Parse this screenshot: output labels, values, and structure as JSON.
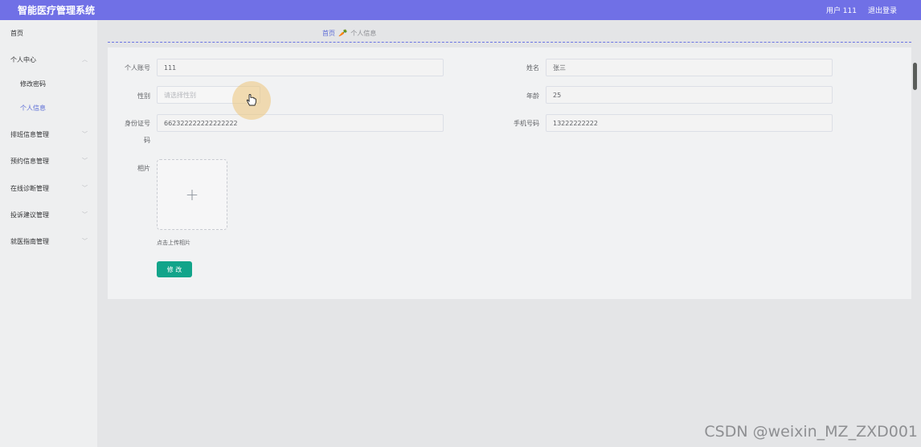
{
  "header": {
    "app_title": "智能医疗管理系统",
    "user_label": "用户 111",
    "logout_label": "退出登录"
  },
  "sidebar": {
    "items": [
      {
        "label": "首页",
        "expandable": false
      },
      {
        "label": "个人中心",
        "expandable": true,
        "expanded": true
      },
      {
        "label": "修改密码",
        "sub": true
      },
      {
        "label": "个人信息",
        "sub": true,
        "active": true
      },
      {
        "label": "排班信息管理",
        "expandable": true
      },
      {
        "label": "预约信息管理",
        "expandable": true
      },
      {
        "label": "在线诊断管理",
        "expandable": true
      },
      {
        "label": "投诉建议管理",
        "expandable": true
      },
      {
        "label": "就医指南管理",
        "expandable": true
      }
    ],
    "chevron_icon": "chevron-down-icon",
    "active_color": "#5b6cd6"
  },
  "breadcrumb": {
    "home": "首页",
    "separator_icon": "carrot-icon",
    "current": "个人信息"
  },
  "form": {
    "account": {
      "label": "个人账号",
      "value": "111"
    },
    "name": {
      "label": "姓名",
      "value": "张三"
    },
    "gender": {
      "label": "性别",
      "placeholder": "请选择性别"
    },
    "age": {
      "label": "年龄",
      "value": "25"
    },
    "id_card": {
      "label_line1": "身份证号",
      "label_line2": "码",
      "value": "662322222222222222"
    },
    "phone": {
      "label": "手机号码",
      "value": "13222222222"
    },
    "photo": {
      "label": "相片",
      "upload_tip": "点击上传相片",
      "plus_icon": "plus-icon"
    },
    "submit_label": "修 改"
  },
  "colors": {
    "topbar": "#7070e6",
    "submit_button": "#12a48a",
    "breadcrumb_link": "#5c6cd6"
  },
  "watermark": "CSDN @weixin_MZ_ZXD001"
}
